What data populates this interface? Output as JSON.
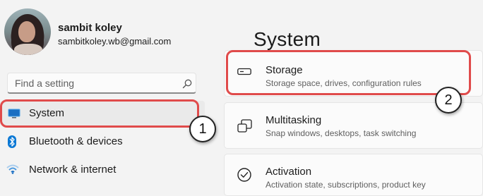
{
  "profile": {
    "name": "sambit koley",
    "email": "sambitkoley.wb@gmail.com"
  },
  "search": {
    "placeholder": "Find a setting",
    "icon": "search-icon"
  },
  "nav": [
    {
      "label": "System",
      "icon": "system-icon",
      "selected": true
    },
    {
      "label": "Bluetooth & devices",
      "icon": "bluetooth-icon",
      "selected": false
    },
    {
      "label": "Network & internet",
      "icon": "wifi-icon",
      "selected": false
    }
  ],
  "main": {
    "title": "System",
    "cards": [
      {
        "title": "Storage",
        "subtitle": "Storage space, drives, configuration rules",
        "icon": "storage-icon"
      },
      {
        "title": "Multitasking",
        "subtitle": "Snap windows, desktops, task switching",
        "icon": "multitasking-icon"
      },
      {
        "title": "Activation",
        "subtitle": "Activation state, subscriptions, product key",
        "icon": "activation-icon"
      }
    ]
  },
  "annotations": {
    "badge_1": "1",
    "badge_2": "2",
    "highlight_color": "#e04b4b"
  },
  "colors": {
    "accent": "#0067c0",
    "background": "#f3f3f3",
    "card": "#fbfbfb"
  }
}
